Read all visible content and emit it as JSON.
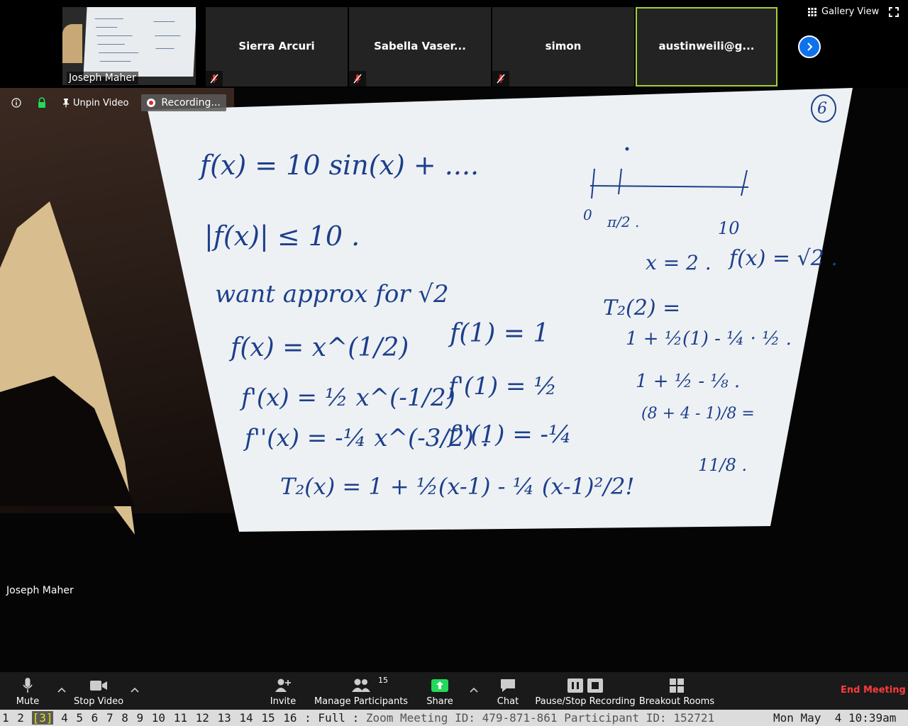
{
  "gallery": {
    "self": {
      "name": "Joseph Maher"
    },
    "tiles": [
      {
        "name": "Sierra Arcuri",
        "muted": true
      },
      {
        "name": "Sabella Vaser...",
        "muted": true
      },
      {
        "name": "simon",
        "muted": true
      },
      {
        "name": "austinweili@g...",
        "muted": false,
        "active": true
      }
    ],
    "view_label": "Gallery View"
  },
  "video_bar": {
    "unpin_label": "Unpin Video",
    "recording_label": "Recording..."
  },
  "speaker": {
    "name": "Joseph Maher"
  },
  "whiteboard": {
    "page_number": "6",
    "lines": [
      "f(x) = 10 sin(x) + ....",
      "|f(x)| ≤ 10 .",
      "want approx for √2",
      "f(x) = x^(1/2)",
      "f(1) = 1",
      "f'(x) = ½ x^(-1/2)",
      "f'(1) = ½",
      "f''(x) = -¼ x^(-3/2) .",
      "f''(1) = -¼",
      "T₂(x) = 1 + ½(x-1) - ¼ (x-1)²/2!",
      "0",
      "π/2 .",
      "10",
      "x = 2 .",
      "f(x) = √2 .",
      "T₂(2) =",
      "1 + ½(1) - ¼ · ½ .",
      "1 + ½ - ⅛ .",
      "(8 + 4 - 1)/8 =",
      "11/8 ."
    ]
  },
  "toolbar": {
    "mute": "Mute",
    "stop_video": "Stop Video",
    "invite": "Invite",
    "manage_participants": "Manage Participants",
    "participant_count": "15",
    "share": "Share",
    "chat": "Chat",
    "pause_stop_recording": "Pause/Stop Recording",
    "breakout_rooms": "Breakout Rooms",
    "end_meeting": "End Meeting"
  },
  "status_bar": {
    "workspaces": [
      "1",
      "2",
      "3",
      "4",
      "5",
      "6",
      "7",
      "8",
      "9",
      "10",
      "11",
      "12",
      "13",
      "14",
      "15",
      "16"
    ],
    "current_workspace": "3",
    "mode": ": Full :",
    "window_title": "Zoom Meeting ID: 479-871-861 Participant ID: 152721",
    "datetime": "Mon May  4 10:39am"
  },
  "colors": {
    "accent_blue": "#0e72ed",
    "active_border": "#a3cf3a",
    "end_meeting_red": "#ff3b3b",
    "share_green": "#23d959",
    "ink": "#1c3f8c"
  }
}
